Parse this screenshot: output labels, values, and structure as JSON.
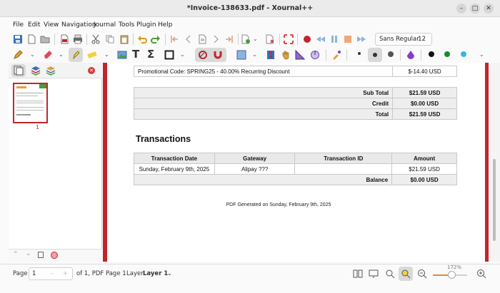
{
  "window": {
    "title": "*Invoice-138633.pdf - Xournal++"
  },
  "menu": [
    "File",
    "Edit",
    "View",
    "Navigation",
    "Journal",
    "Tools",
    "Plugin",
    "Help"
  ],
  "toolbar": {
    "font_name": "Sans Regular",
    "font_size": "12"
  },
  "sidebar": {
    "thumbnail_page": "1"
  },
  "invoice": {
    "promo_row": {
      "label": "Promotional Code: SPRING25 - 40.00% Recurring Discount",
      "amount": "$-14.40 USD"
    },
    "totals": [
      {
        "label": "Sub Total",
        "amount": "$21.59 USD"
      },
      {
        "label": "Credit",
        "amount": "$0.00 USD"
      },
      {
        "label": "Total",
        "amount": "$21.59 USD"
      }
    ],
    "transactions_title": "Transactions",
    "transactions_headers": [
      "Transaction Date",
      "Gateway",
      "Transaction ID",
      "Amount"
    ],
    "transactions_rows": [
      {
        "date": "Sunday, February 9th, 2025",
        "gateway": "Alipay ???",
        "id": "",
        "amount": "$21.59 USD"
      }
    ],
    "balance": {
      "label": "Balance",
      "amount": "$0.00 USD"
    },
    "generated_note": "PDF Generated on Sunday, February 9th, 2025"
  },
  "status": {
    "page_label": "Page",
    "page_value": "1",
    "page_of": "of 1, PDF Page 1",
    "layer_label": "Layer",
    "layer_value": "Layer 1",
    "zoom": "172%",
    "zoom_fraction": 0.55
  },
  "colors": {
    "accent": "#c0262d",
    "highlight": "#e08a3a"
  }
}
